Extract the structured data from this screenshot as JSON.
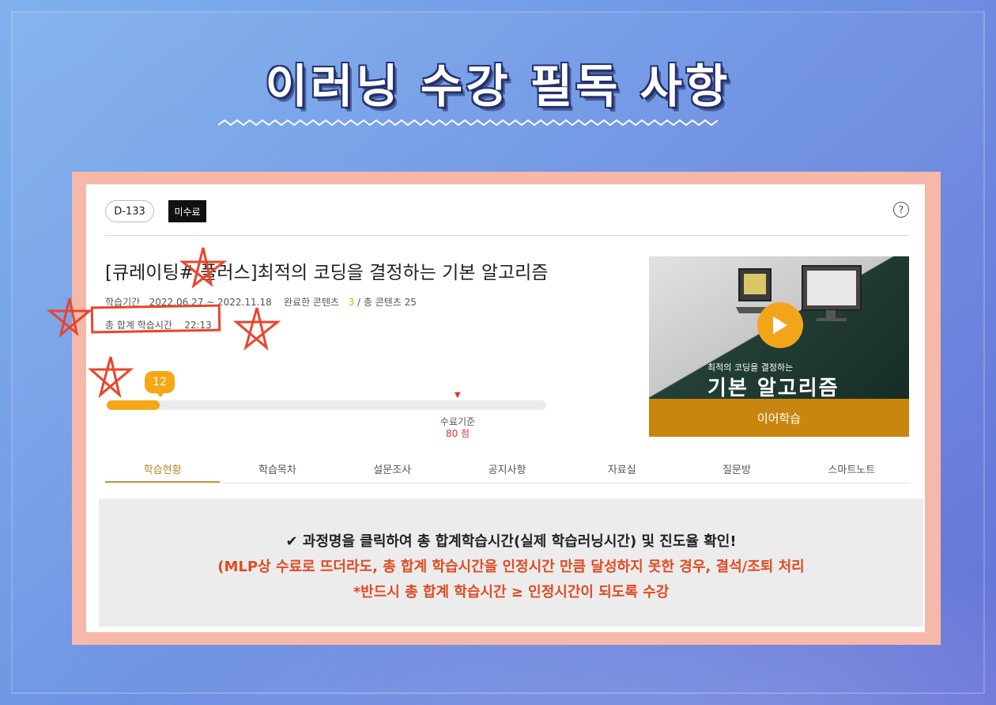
{
  "headline": "이러닝 수강 필독 사항",
  "course_panel": {
    "d_day": "D-133",
    "status": "미수료",
    "help_icon": "question-circle-icon",
    "title": "[큐레이팅# 플러스]최적의 코딩을 결정하는 기본 알고리즘",
    "period_label": "학습기간",
    "period_value": "2022.06.27 ~ 2022.11.18",
    "completed_label": "완료한 콘텐츠",
    "completed_value": "3",
    "total_label": "/ 총 콘텐츠 25",
    "total_time_label": "총 합계 학습시간",
    "total_time_value": "22:13",
    "progress_value": "12",
    "progress_percent": 12,
    "completion_label": "수료기준",
    "completion_value": "80 점",
    "thumbnail": {
      "subtitle": "최적의 코딩을 결정하는",
      "big_title": "기본 알고리즘",
      "resume_button": "이어학습"
    },
    "tabs": [
      "학습현황",
      "학습목차",
      "설문조사",
      "공지사항",
      "자료실",
      "질문방",
      "스마트노트"
    ],
    "active_tab": 0
  },
  "notice": {
    "line1": "✔ 과정명을 클릭하여 총 합계학습시간(실제 학습러닝시간) 및 진도율 확인!",
    "line2": "(MLP상 수료로 뜨더라도, 총 합계 학습시간을 인정시간 만큼 달성하지 못한 경우, 결석/조퇴 처리",
    "line3": "*반드시 총 합계 학습시간 ≥ 인정시간이 되도록 수강"
  },
  "colors": {
    "accent": "#f5a716",
    "annotation": "#e8452c",
    "notice_red": "#e04b23",
    "card_border": "#f6b8a8"
  }
}
